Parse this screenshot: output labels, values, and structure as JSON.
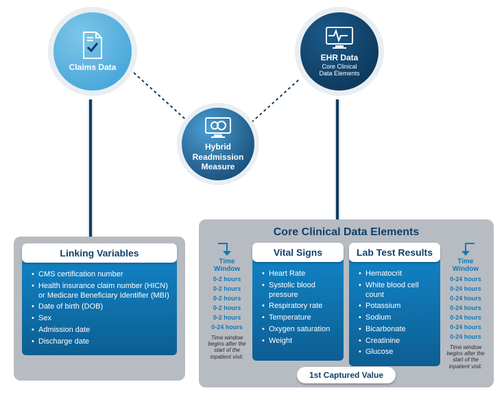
{
  "circles": {
    "claims": {
      "title": "Claims Data"
    },
    "ehr": {
      "title": "EHR Data",
      "subtitle": "Core Clinical\nData Elements"
    },
    "hybrid": {
      "title": "Hybrid\nReadmission\nMeasure"
    }
  },
  "left_panel": {
    "tab": "Linking Variables",
    "items": [
      "CMS certification number",
      "Health insurance claim number (HICN) or Medicare Beneficiary Identifier (MBI)",
      "Date of birth (DOB)",
      "Sex",
      "Admission date",
      "Discharge date"
    ]
  },
  "right_panel": {
    "title": "Core Clinical Data Elements",
    "time_window_label": "Time Window",
    "time_note": "Time window begins after the start of the inpatient visit.",
    "vital": {
      "tab": "Vital Signs",
      "items": [
        "Heart Rate",
        "Systolic blood pressure",
        "Respiratory rate",
        "Temperature",
        "Oxygen saturation",
        "Weight"
      ],
      "windows": [
        "0-2 hours",
        "0-2 hours",
        "0-2 hours",
        "0-2 hours",
        "0-2 hours",
        "0-24 hours"
      ]
    },
    "lab": {
      "tab": "Lab Test Results",
      "items": [
        "Hematocrit",
        "White blood cell count",
        "Potassium",
        "Sodium",
        "Bicarbonate",
        "Creatinine",
        "Glucose"
      ],
      "windows": [
        "0-24 hours",
        "0-24 hours",
        "0-24 hours",
        "0-24 hours",
        "0-24 hours",
        "0-24 hours",
        "0-24 hours"
      ]
    },
    "captured": "1st Captured Value"
  }
}
